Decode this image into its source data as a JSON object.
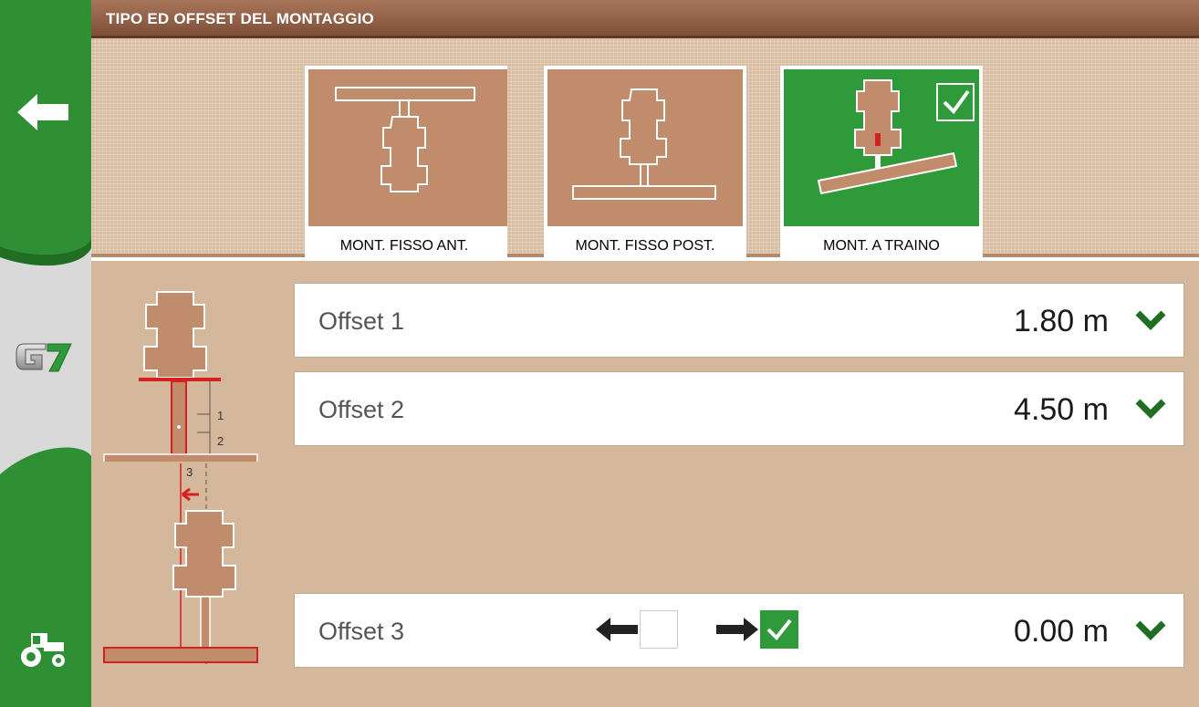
{
  "header": {
    "title": "TIPO ED OFFSET DEL MONTAGGIO"
  },
  "sidebar": {
    "items": [
      {
        "name": "back",
        "icon": "back-arrow-icon"
      },
      {
        "name": "home",
        "icon": "g7-logo-icon",
        "label": "G7"
      },
      {
        "name": "vehicle",
        "icon": "tractor-icon"
      }
    ]
  },
  "mount_types": [
    {
      "label": "MONT. FISSO ANT.",
      "selected": false
    },
    {
      "label": "MONT. FISSO POST.",
      "selected": false
    },
    {
      "label": "MONT. A TRAINO",
      "selected": true
    }
  ],
  "diagram_labels": {
    "one": "1",
    "two": "2",
    "three": "3"
  },
  "offsets": [
    {
      "name": "Offset 1",
      "value": "1.80 m"
    },
    {
      "name": "Offset 2",
      "value": "4.50 m"
    },
    {
      "name": "Offset 3",
      "value": "0.00 m",
      "direction_left_checked": false,
      "direction_right_checked": true
    }
  ],
  "colors": {
    "accent_green": "#2f9a3a",
    "brown": "#c08c6b",
    "header_brown": "#8b5a40",
    "warning_red": "#d42020"
  }
}
